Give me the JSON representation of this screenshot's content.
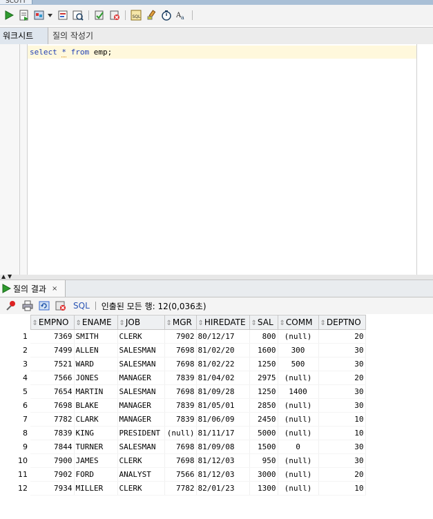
{
  "window": {
    "tab_title": "SCOTT"
  },
  "subtabs": [
    "워크시트",
    "질의 작성기"
  ],
  "editor": {
    "kw_select": "select",
    "star": "*",
    "kw_from": "from",
    "rest": "emp;"
  },
  "results": {
    "tab_label": "질의 결과",
    "close_glyph": "×",
    "sql_link": "SQL",
    "status": "인출된 모든 행: 12(0,036초)",
    "columns": [
      "EMPNO",
      "ENAME",
      "JOB",
      "MGR",
      "HIREDATE",
      "SAL",
      "COMM",
      "DEPTNO"
    ],
    "rows": [
      [
        "1",
        "7369",
        "SMITH",
        "CLERK",
        "7902",
        "80/12/17",
        "800",
        "(null)",
        "20"
      ],
      [
        "2",
        "7499",
        "ALLEN",
        "SALESMAN",
        "7698",
        "81/02/20",
        "1600",
        "300",
        "30"
      ],
      [
        "3",
        "7521",
        "WARD",
        "SALESMAN",
        "7698",
        "81/02/22",
        "1250",
        "500",
        "30"
      ],
      [
        "4",
        "7566",
        "JONES",
        "MANAGER",
        "7839",
        "81/04/02",
        "2975",
        "(null)",
        "20"
      ],
      [
        "5",
        "7654",
        "MARTIN",
        "SALESMAN",
        "7698",
        "81/09/28",
        "1250",
        "1400",
        "30"
      ],
      [
        "6",
        "7698",
        "BLAKE",
        "MANAGER",
        "7839",
        "81/05/01",
        "2850",
        "(null)",
        "30"
      ],
      [
        "7",
        "7782",
        "CLARK",
        "MANAGER",
        "7839",
        "81/06/09",
        "2450",
        "(null)",
        "10"
      ],
      [
        "8",
        "7839",
        "KING",
        "PRESIDENT",
        "(null)",
        "81/11/17",
        "5000",
        "(null)",
        "10"
      ],
      [
        "9",
        "7844",
        "TURNER",
        "SALESMAN",
        "7698",
        "81/09/08",
        "1500",
        "0",
        "30"
      ],
      [
        "10",
        "7900",
        "JAMES",
        "CLERK",
        "7698",
        "81/12/03",
        "950",
        "(null)",
        "30"
      ],
      [
        "11",
        "7902",
        "FORD",
        "ANALYST",
        "7566",
        "81/12/03",
        "3000",
        "(null)",
        "20"
      ],
      [
        "12",
        "7934",
        "MILLER",
        "CLERK",
        "7782",
        "82/01/23",
        "1300",
        "(null)",
        "10"
      ]
    ]
  },
  "colors": {
    "accent_green": "#2e9b2e",
    "keyword_blue": "#1f3fb4",
    "current_line": "#fff8dc"
  },
  "icons": [
    "run-statement-icon",
    "run-script-icon",
    "autotrace-icon",
    "explain-plan-icon",
    "sql-tuning-icon",
    "commit-icon",
    "rollback-icon",
    "sql-history-icon",
    "clear-icon",
    "format-icon",
    "change-case-icon",
    "pin-icon",
    "print-icon",
    "refresh-icon",
    "delete-icon"
  ]
}
